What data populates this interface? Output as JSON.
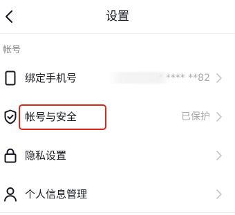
{
  "header": {
    "title": "设置",
    "back_icon": "chevron-left-icon"
  },
  "section": {
    "label": "帐号"
  },
  "rows": [
    {
      "label": "绑定手机号",
      "value": "+86 13* **** **82",
      "icon": "phone-icon"
    },
    {
      "label": "帐号与安全",
      "value": "已保护",
      "icon": "shield-check-icon"
    },
    {
      "label": "隐私设置",
      "value": "",
      "icon": "lock-icon"
    },
    {
      "label": "个人信息管理",
      "value": "",
      "icon": "person-icon"
    }
  ],
  "colors": {
    "text": "#161823",
    "secondary": "#a8a9ad",
    "highlight": "#d9281a",
    "divider": "#ededee"
  }
}
